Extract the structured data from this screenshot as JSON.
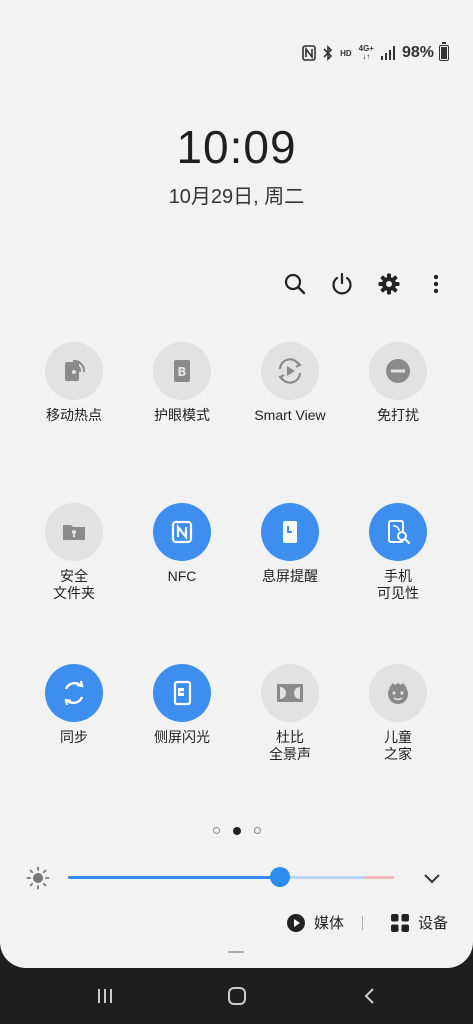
{
  "status_bar": {
    "hd": "HD",
    "network": "4G+",
    "battery_percent": "98%",
    "icons": [
      "nfc-icon",
      "bluetooth-icon",
      "signal-icon",
      "battery-icon"
    ]
  },
  "clock": {
    "time": "10:09",
    "date": "10月29日, 周二"
  },
  "actions": [
    "search-icon",
    "power-icon",
    "settings-icon",
    "more-icon"
  ],
  "tiles": [
    {
      "label": "移动热点",
      "on": false,
      "icon": "hotspot-icon"
    },
    {
      "label": "护眼模式",
      "on": false,
      "icon": "eye-comfort-icon"
    },
    {
      "label": "Smart View",
      "on": false,
      "icon": "smart-view-icon"
    },
    {
      "label": "免打扰",
      "on": false,
      "icon": "do-not-disturb-icon"
    },
    {
      "label": "安全\n文件夹",
      "on": false,
      "icon": "secure-folder-icon"
    },
    {
      "label": "NFC",
      "on": true,
      "icon": "nfc-icon"
    },
    {
      "label": "息屏提醒",
      "on": true,
      "icon": "always-on-display-icon"
    },
    {
      "label": "手机\n可见性",
      "on": true,
      "icon": "phone-visibility-icon"
    },
    {
      "label": "同步",
      "on": true,
      "icon": "sync-icon"
    },
    {
      "label": "侧屏闪光",
      "on": true,
      "icon": "edge-lighting-icon"
    },
    {
      "label": "杜比\n全景声",
      "on": false,
      "icon": "dolby-atmos-icon"
    },
    {
      "label": "儿童\n之家",
      "on": false,
      "icon": "kids-home-icon"
    }
  ],
  "pager": {
    "count": 3,
    "active": 1
  },
  "brightness": {
    "level": 0.65
  },
  "media": {
    "media_label": "媒体",
    "devices_label": "设备"
  },
  "colors": {
    "accent": "#3e8ef0",
    "tile_off": "#e2e2e2",
    "panel": "#f2f2f2"
  }
}
